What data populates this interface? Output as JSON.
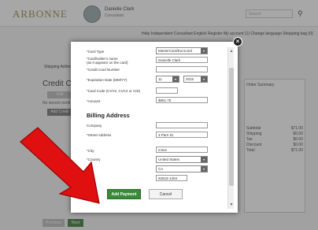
{
  "bg": {
    "logo": "ARBONNE",
    "user_name": "Danielle Clark",
    "user_sub": "Consultant",
    "search_placeholder": "Search",
    "topnav": "Help   Independent Consultant   English   Register   My account (1)   Change language   Shopping bag (0)",
    "shipping": "Shipping Address",
    "credit_card_title": "Credit Card",
    "small_btn": "Add",
    "small_text": "No stored credit cards",
    "small_btn2": "Add Credit Card",
    "right_label": "Order Summary",
    "right_rows": [
      {
        "label": "Subtotal",
        "value": "$71.00"
      },
      {
        "label": "Shipping",
        "value": "$0.00"
      },
      {
        "label": "Tax",
        "value": "$0.00"
      },
      {
        "label": "Discount",
        "value": "$0.00"
      },
      {
        "label": "Total",
        "value": "$71.00"
      }
    ],
    "bottom_btn1": "Previous",
    "bottom_btn2": "Next"
  },
  "modal": {
    "card_type_label": "*Card Type",
    "card_type_value": "MasterCard/Eurocard",
    "cardholder_label": "*Cardholder's name",
    "cardholder_hint": "(as it appears on the card)",
    "cardholder_value": "Danielle Clark",
    "card_number_label": "*Credit Card Number",
    "card_number_value": "",
    "expiration_label": "*Expiration Date (MM/YY)",
    "exp_month": "11",
    "exp_year": "2015",
    "cvv_label": "*Card Code (CVV2, CVC2 or CID)",
    "cvv_value": "",
    "amount_label": "*Amount",
    "amount_value": "$951.75",
    "billing_title": "Billing Address",
    "company_label": "Company",
    "company_value": "",
    "street_label": "*Street Address",
    "street_value": "3 Parn St.",
    "city_label": "*City",
    "city_value": "Irvine",
    "country_label": "*Country",
    "country_value": "United States",
    "state_value": "CA",
    "zip_value": "92618-1403",
    "add_payment": "Add Payment",
    "cancel": "Cancel",
    "close_icon": "×"
  },
  "colors": {
    "accent_green": "#3a8a3a",
    "arrow_red": "#e01010"
  }
}
